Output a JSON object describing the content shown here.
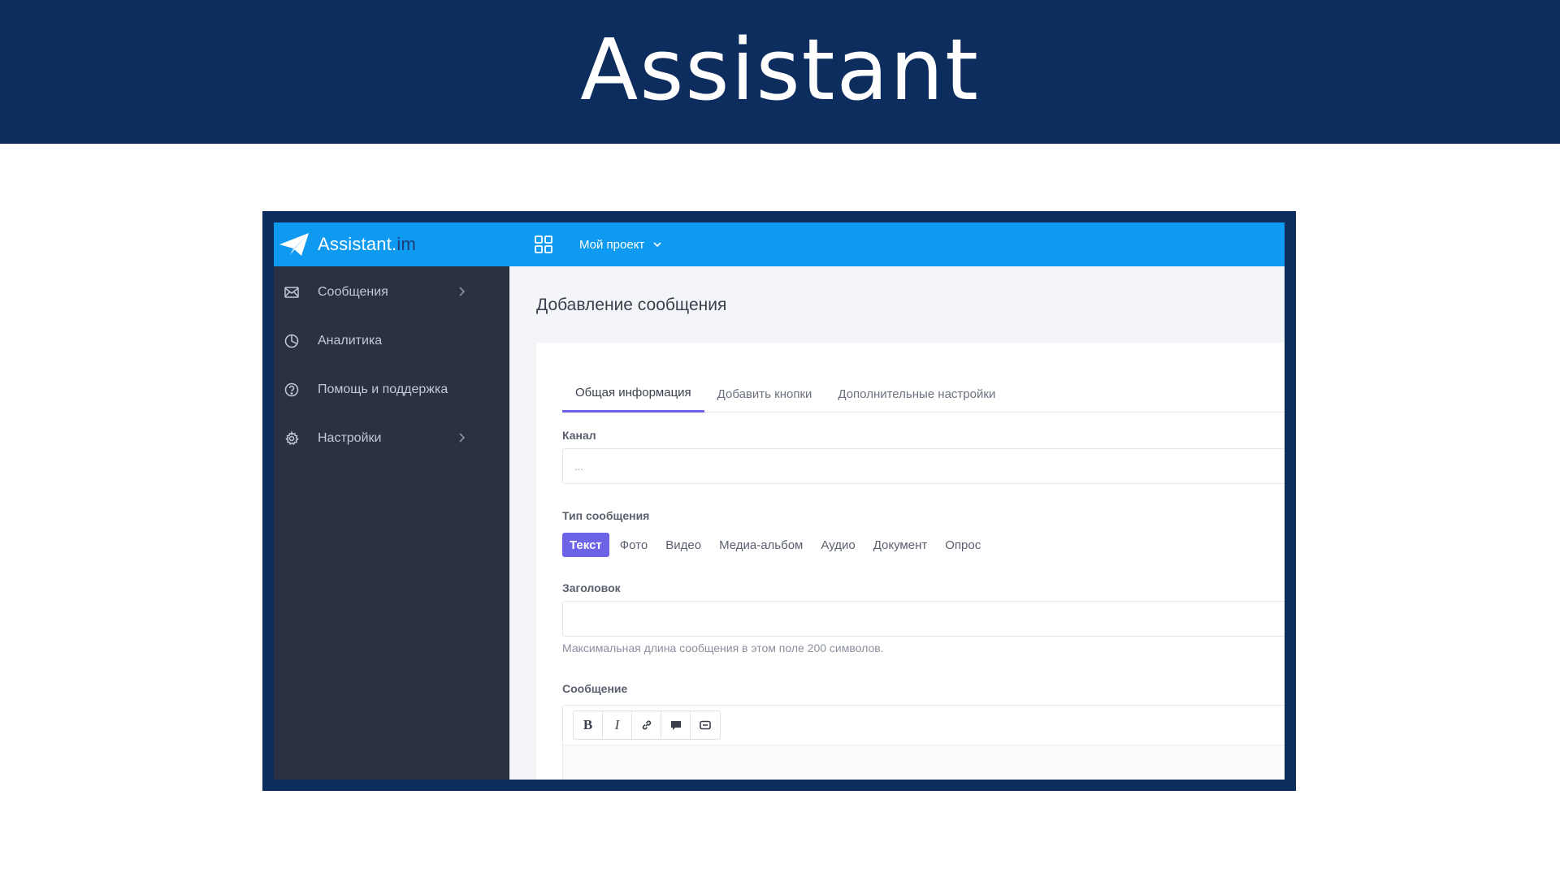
{
  "banner": {
    "title": "Assistant"
  },
  "app": {
    "logo": {
      "name": "Assistant.",
      "suffix": "im",
      "icon": "paper-plane-icon"
    },
    "topbar": {
      "grid_icon": "grid-icon",
      "project_label": "Мой проект",
      "accent": "#0e9af0"
    },
    "sidebar": {
      "items": [
        {
          "label": "Сообщения",
          "icon": "envelope-icon",
          "has_chevron": true
        },
        {
          "label": "Аналитика",
          "icon": "pie-chart-icon",
          "has_chevron": false
        },
        {
          "label": "Помощь и поддержка",
          "icon": "question-circle-icon",
          "has_chevron": false
        },
        {
          "label": "Настройки",
          "icon": "gear-icon",
          "has_chevron": true
        }
      ]
    },
    "page_title": "Добавление сообщения",
    "tabs": [
      {
        "label": "Общая информация",
        "active": true
      },
      {
        "label": "Добавить кнопки",
        "active": false
      },
      {
        "label": "Дополнительные настройки",
        "active": false
      }
    ],
    "form": {
      "channel_label": "Канал",
      "channel_value": "...",
      "type_label": "Тип сообщения",
      "types": [
        {
          "label": "Текст",
          "active": true
        },
        {
          "label": "Фото",
          "active": false
        },
        {
          "label": "Видео",
          "active": false
        },
        {
          "label": "Медиа-альбом",
          "active": false
        },
        {
          "label": "Аудио",
          "active": false
        },
        {
          "label": "Документ",
          "active": false
        },
        {
          "label": "Опрос",
          "active": false
        }
      ],
      "title_label": "Заголовок",
      "title_value": "",
      "title_hint": "Максимальная длина сообщения в этом поле 200 символов.",
      "message_label": "Сообщение",
      "toolbar": {
        "bold": "B",
        "italic": "I"
      }
    },
    "colors": {
      "primary": "#6c63e6",
      "sidebar": "#2b3142",
      "frame": "#0d2d5e"
    }
  }
}
